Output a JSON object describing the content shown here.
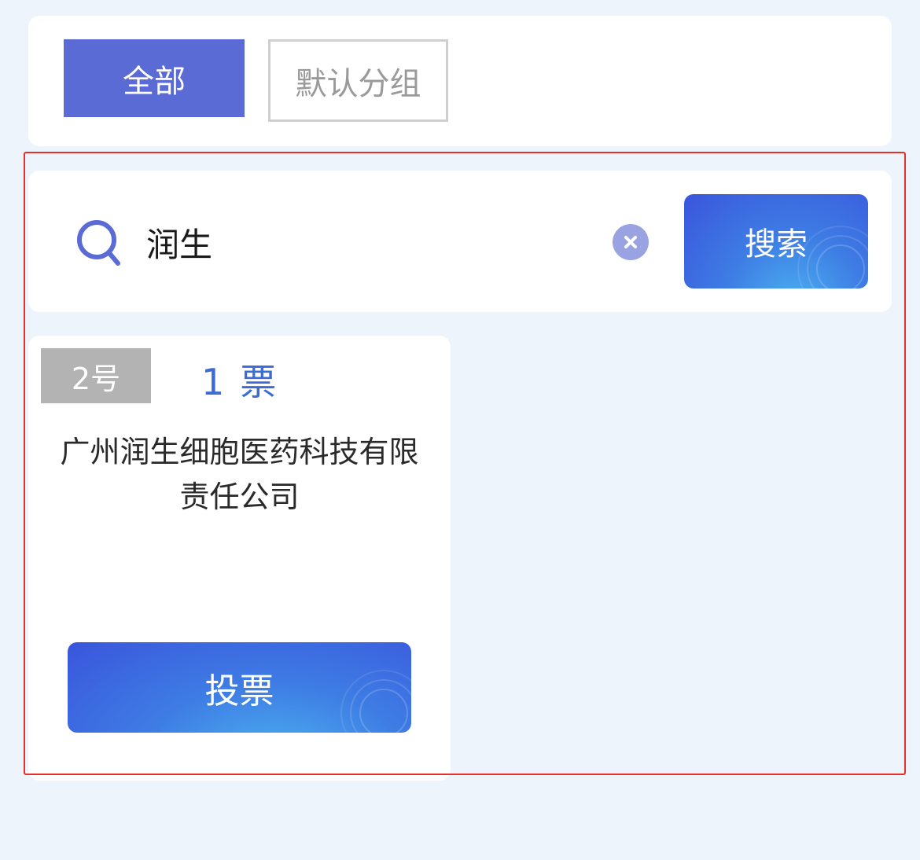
{
  "tabs": {
    "all_label": "全部",
    "default_group_label": "默认分组"
  },
  "search": {
    "query": "润生",
    "button_label": "搜索"
  },
  "candidates": [
    {
      "number": "2号",
      "vote_count": "1",
      "vote_unit": "票",
      "name": "广州润生细胞医药科技有限责任公司",
      "vote_button_label": "投票"
    }
  ],
  "colors": {
    "active_tab": "#5A6BD6",
    "accent_blue": "#3A6BD6",
    "highlight_frame": "#E5302A",
    "badge_gray": "#B3B3B3"
  },
  "icons": {
    "search": "search-icon",
    "clear": "clear-icon"
  }
}
